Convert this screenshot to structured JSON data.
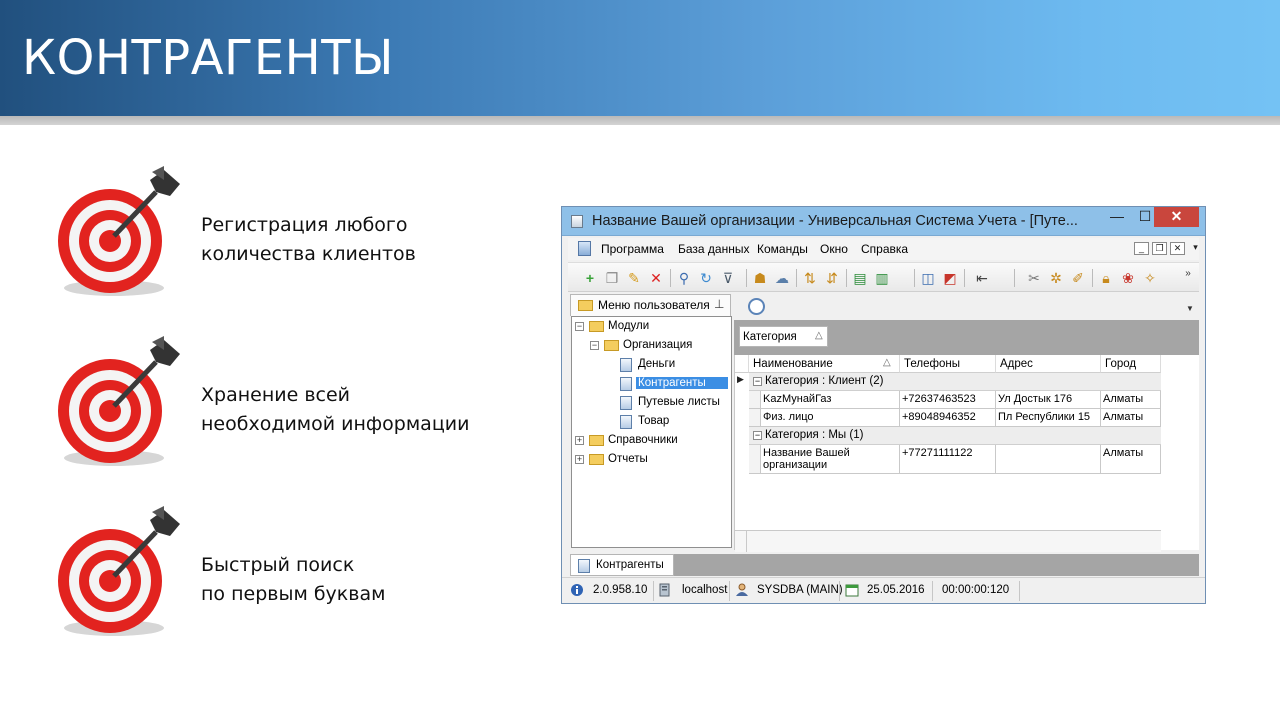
{
  "slide": {
    "title": "КОНТРАГЕНТЫ"
  },
  "features": [
    {
      "line1": "Регистрация любого",
      "line2": "количества клиентов"
    },
    {
      "line1": "Хранение всей",
      "line2": "необходимой информации"
    },
    {
      "line1": "Быстрый поиск",
      "line2": "по первым буквам"
    }
  ],
  "window": {
    "title": "Название Вашей организации - Универсальная Система Учета - [Путе...",
    "controls": {
      "minimize": "—",
      "maximize": "☐",
      "close": "✕"
    },
    "menu": [
      "Программа",
      "База данных",
      "Команды",
      "Окно",
      "Справка"
    ],
    "left_panel": {
      "tab_label": "Меню пользователя",
      "tree": {
        "root": "Модули",
        "org": "Организация",
        "org_children": [
          "Деньги",
          "Контрагенты",
          "Путевые листы",
          "Товар"
        ],
        "ref": "Справочники",
        "reports": "Отчеты"
      },
      "selected": "Контрагенты"
    },
    "grid": {
      "group_by": "Категория",
      "columns": [
        "Наименование",
        "Телефоны",
        "Адрес",
        "Город"
      ],
      "groups": [
        {
          "label": "Категория : Клиент (2)",
          "rows": [
            [
              "KazМунайГаз",
              "+72637463523",
              "Ул Достык 176",
              "Алматы"
            ],
            [
              "Физ. лицо",
              "+89048946352",
              "Пл Республики 15",
              "Алматы"
            ]
          ]
        },
        {
          "label": "Категория : Мы (1)",
          "rows": [
            [
              "Название Вашей организации",
              "+77271111122",
              "",
              "Алматы"
            ]
          ]
        }
      ]
    },
    "bottom_tab": "Контрагенты",
    "status": {
      "version": "2.0.958.10",
      "host": "localhost",
      "user": "SYSDBA (MAIN)",
      "date": "25.05.2016",
      "timer": "00:00:00:120"
    }
  },
  "colors": {
    "header_dark": "#21507e",
    "header_light": "#74c2f4",
    "selection": "#3b8ee4",
    "close_button": "#c9463d"
  }
}
